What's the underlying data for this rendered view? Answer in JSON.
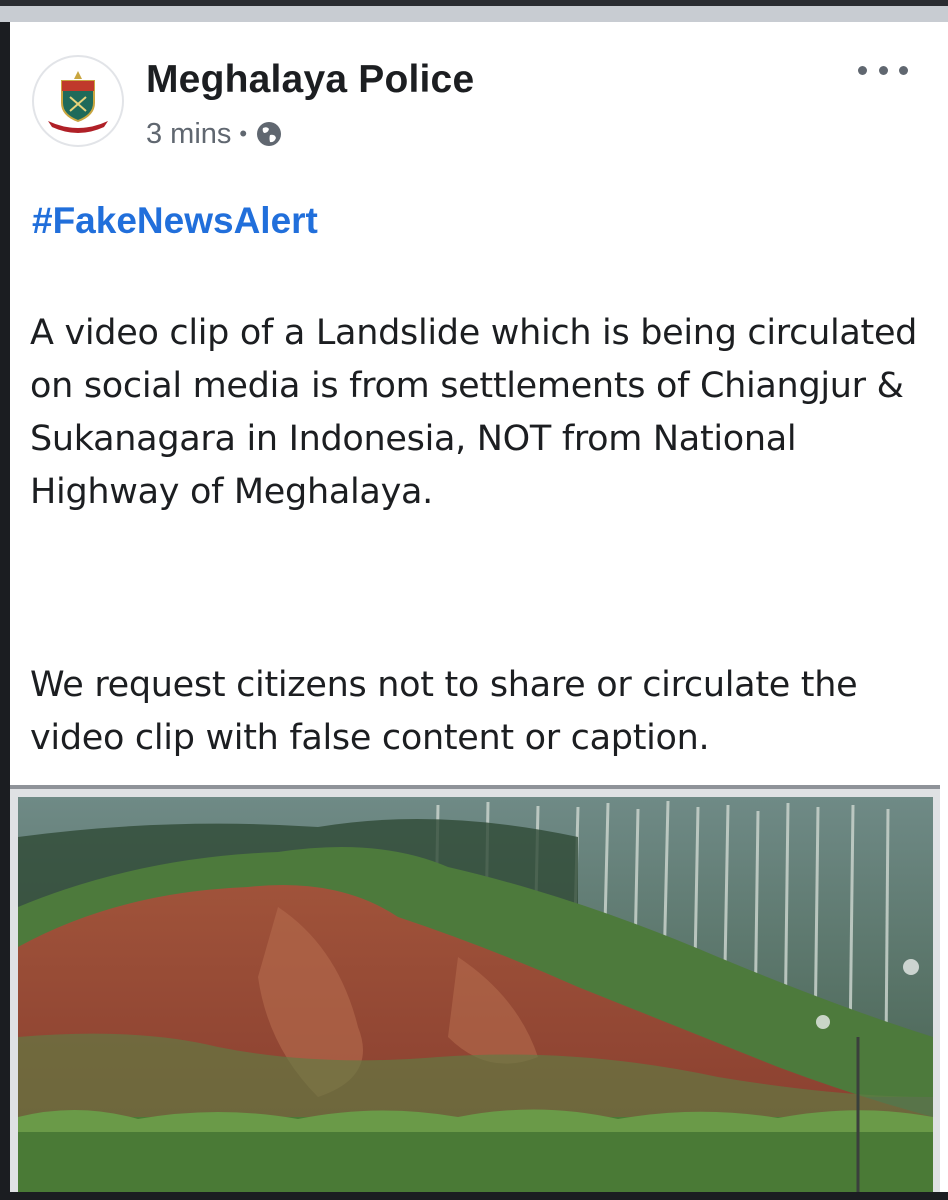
{
  "post": {
    "page_name": "Meghalaya Police",
    "timestamp": "3 mins",
    "separator": "•",
    "privacy_icon": "globe-icon",
    "hashtag": "#FakeNewsAlert",
    "paragraphs": [
      "A video clip of a Landslide which is being circulated on social media is from settlements of Chiangjur & Sukanagara in Indonesia, NOT from National Highway of Meghalaya.",
      "We request citizens not to share or circulate the video clip with false content or caption."
    ],
    "more_icon": "more-options-icon",
    "media": {
      "kind": "video-thumbnail",
      "close_glyph": "×"
    }
  },
  "colors": {
    "link": "#216fdb",
    "text": "#1c1e21",
    "meta": "#606770",
    "soil": "#9a4a32",
    "foliage": "#4d7a3c"
  }
}
